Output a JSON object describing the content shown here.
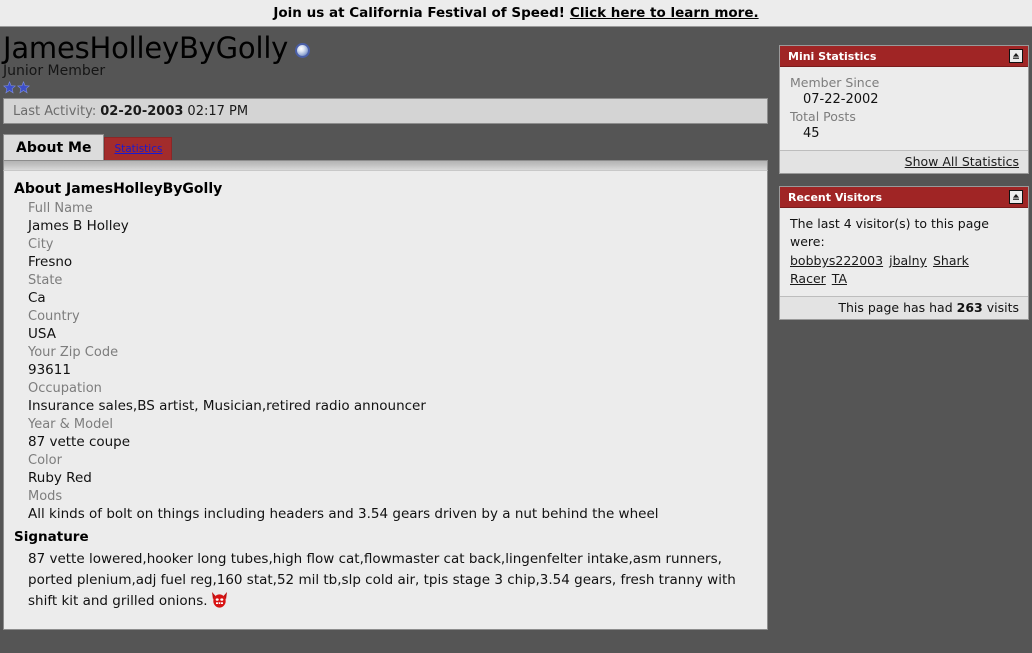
{
  "announcement": {
    "text": "Join us at California Festival of Speed!",
    "link_text": "Click here to learn more."
  },
  "profile": {
    "username": "JamesHolleyByGolly",
    "user_title": "Junior Member",
    "rank_stars": 2,
    "online_status_icon": "online-status-orb-icon",
    "last_activity_label": "Last Activity:",
    "last_activity_date": "02-20-2003",
    "last_activity_time": "02:17 PM"
  },
  "tabs": [
    {
      "label": "About Me",
      "active": true
    },
    {
      "label": "Statistics",
      "active": false
    }
  ],
  "about": {
    "heading": "About JamesHolleyByGolly",
    "fields": [
      {
        "label": "Full Name",
        "value": "James B Holley"
      },
      {
        "label": "City",
        "value": "Fresno"
      },
      {
        "label": "State",
        "value": "Ca"
      },
      {
        "label": "Country",
        "value": "USA"
      },
      {
        "label": "Your Zip Code",
        "value": "93611"
      },
      {
        "label": "Occupation",
        "value": "Insurance sales,BS artist, Musician,retired radio announcer"
      },
      {
        "label": "Year & Model",
        "value": "87 vette coupe"
      },
      {
        "label": "Color",
        "value": "Ruby Red"
      },
      {
        "label": "Mods",
        "value": "All kinds of bolt on things including headers and 3.54 gears driven by a nut behind the wheel"
      }
    ],
    "signature_heading": "Signature",
    "signature_text": "87 vette lowered,hooker long tubes,high flow cat,flowmaster cat back,lingenfelter intake,asm runners, ported plenium,adj fuel reg,160 stat,52 mil tb,slp cold air, tpis stage 3 chip,3.54 gears, fresh tranny with shift kit and grilled onions.",
    "signature_emoticon": "devil-face-icon"
  },
  "sidebar": {
    "mini_statistics": {
      "title": "Mini Statistics",
      "collapse_icon": "collapse-panel-icon",
      "stats": [
        {
          "label": "Member Since",
          "value": "07-22-2002"
        },
        {
          "label": "Total Posts",
          "value": "45"
        }
      ],
      "footer_link": "Show All Statistics"
    },
    "recent_visitors": {
      "title": "Recent Visitors",
      "collapse_icon": "collapse-panel-icon",
      "intro": "The last 4 visitor(s) to this page were:",
      "visitors": [
        "bobbys222003",
        "jbalny",
        "Shark Racer",
        "TA"
      ],
      "footer_prefix": "This page has had",
      "visit_count": "263",
      "footer_suffix": "visits"
    }
  },
  "colors": {
    "page_background": "#555555",
    "panel_header_red": "#a02525",
    "panel_background": "#ececec",
    "tab_inactive_red": "#a32c2c",
    "link_blue": "#1a1ad0"
  }
}
